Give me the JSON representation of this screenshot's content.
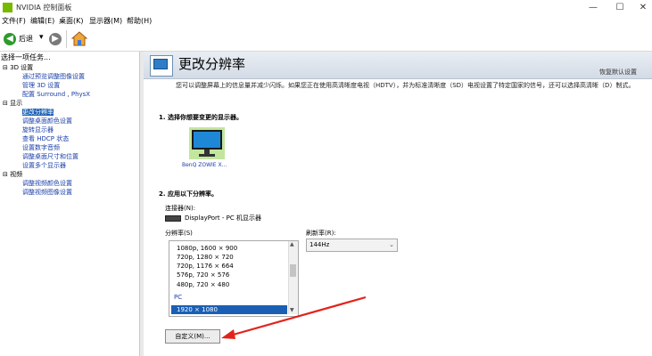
{
  "window": {
    "title": "NVIDIA 控制面板",
    "minimize": "—",
    "maximize": "☐",
    "close": "✕"
  },
  "menu": {
    "items": [
      "文件(F)",
      "编辑(E)",
      "桌面(K)",
      "显示器(M)",
      "帮助(H)"
    ]
  },
  "toolbar": {
    "back_label": "后退",
    "back_dropdown": "▾",
    "icons": [
      "back-arrow-icon",
      "forward-arrow-icon",
      "home-icon"
    ]
  },
  "sidebar": {
    "task_label": "选择一项任务...",
    "tree": [
      {
        "text": "3D 设置",
        "type": "cat",
        "expander": "⊟"
      },
      {
        "text": "通过预览调整图像设置",
        "type": "link"
      },
      {
        "text": "管理 3D 设置",
        "type": "link"
      },
      {
        "text": "配置 Surround , PhysX",
        "type": "link"
      },
      {
        "text": "显示",
        "type": "cat",
        "expander": "⊟"
      },
      {
        "text": "更改分辨率",
        "type": "link",
        "selected": true
      },
      {
        "text": "调整桌面颜色设置",
        "type": "link"
      },
      {
        "text": "旋转显示器",
        "type": "link"
      },
      {
        "text": "查看 HDCP 状态",
        "type": "link"
      },
      {
        "text": "设置数字音频",
        "type": "link"
      },
      {
        "text": "调整桌面尺寸和位置",
        "type": "link"
      },
      {
        "text": "设置多个显示器",
        "type": "link"
      },
      {
        "text": "视频",
        "type": "cat",
        "expander": "⊟"
      },
      {
        "text": "调整视频颜色设置",
        "type": "link"
      },
      {
        "text": "调整视频图像设置",
        "type": "link"
      }
    ]
  },
  "main": {
    "title": "更改分辨率",
    "restore_defaults": "恢复默认设置",
    "description": "您可以调整屏幕上的信息量并减少闪烁。如果您正在使用高清晰度电视（HDTV），并为标准清晰度（SD）电视设置了特定国家的信号，还可以选择高清晰（D）制式。",
    "step1": "1. 选择你想要变更的显示器。",
    "monitor_label": "BenQ ZOWIE X...",
    "step2": "2. 应用以下分辨率。",
    "connector_label": "连接器(N):",
    "connector_value": "DisplayPort - PC 机显示器",
    "resolution_label": "分辨率(S)",
    "resolutions": [
      "1080p, 1600 × 900",
      "720p, 1280 × 720",
      "720p, 1176 × 664",
      "576p, 720 × 576",
      "480p, 720 × 480"
    ],
    "group_pc": "PC",
    "selected_resolution": "1920 × 1080",
    "refresh_label": "刷新率(R):",
    "refresh_value": "144Hz",
    "custom_button": "自定义(M)..."
  },
  "colors": {
    "nvidia_green": "#76b900",
    "selection_blue": "#1a5fb4",
    "annotation_red": "#e2231a",
    "link_blue": "#1a3fa8"
  }
}
